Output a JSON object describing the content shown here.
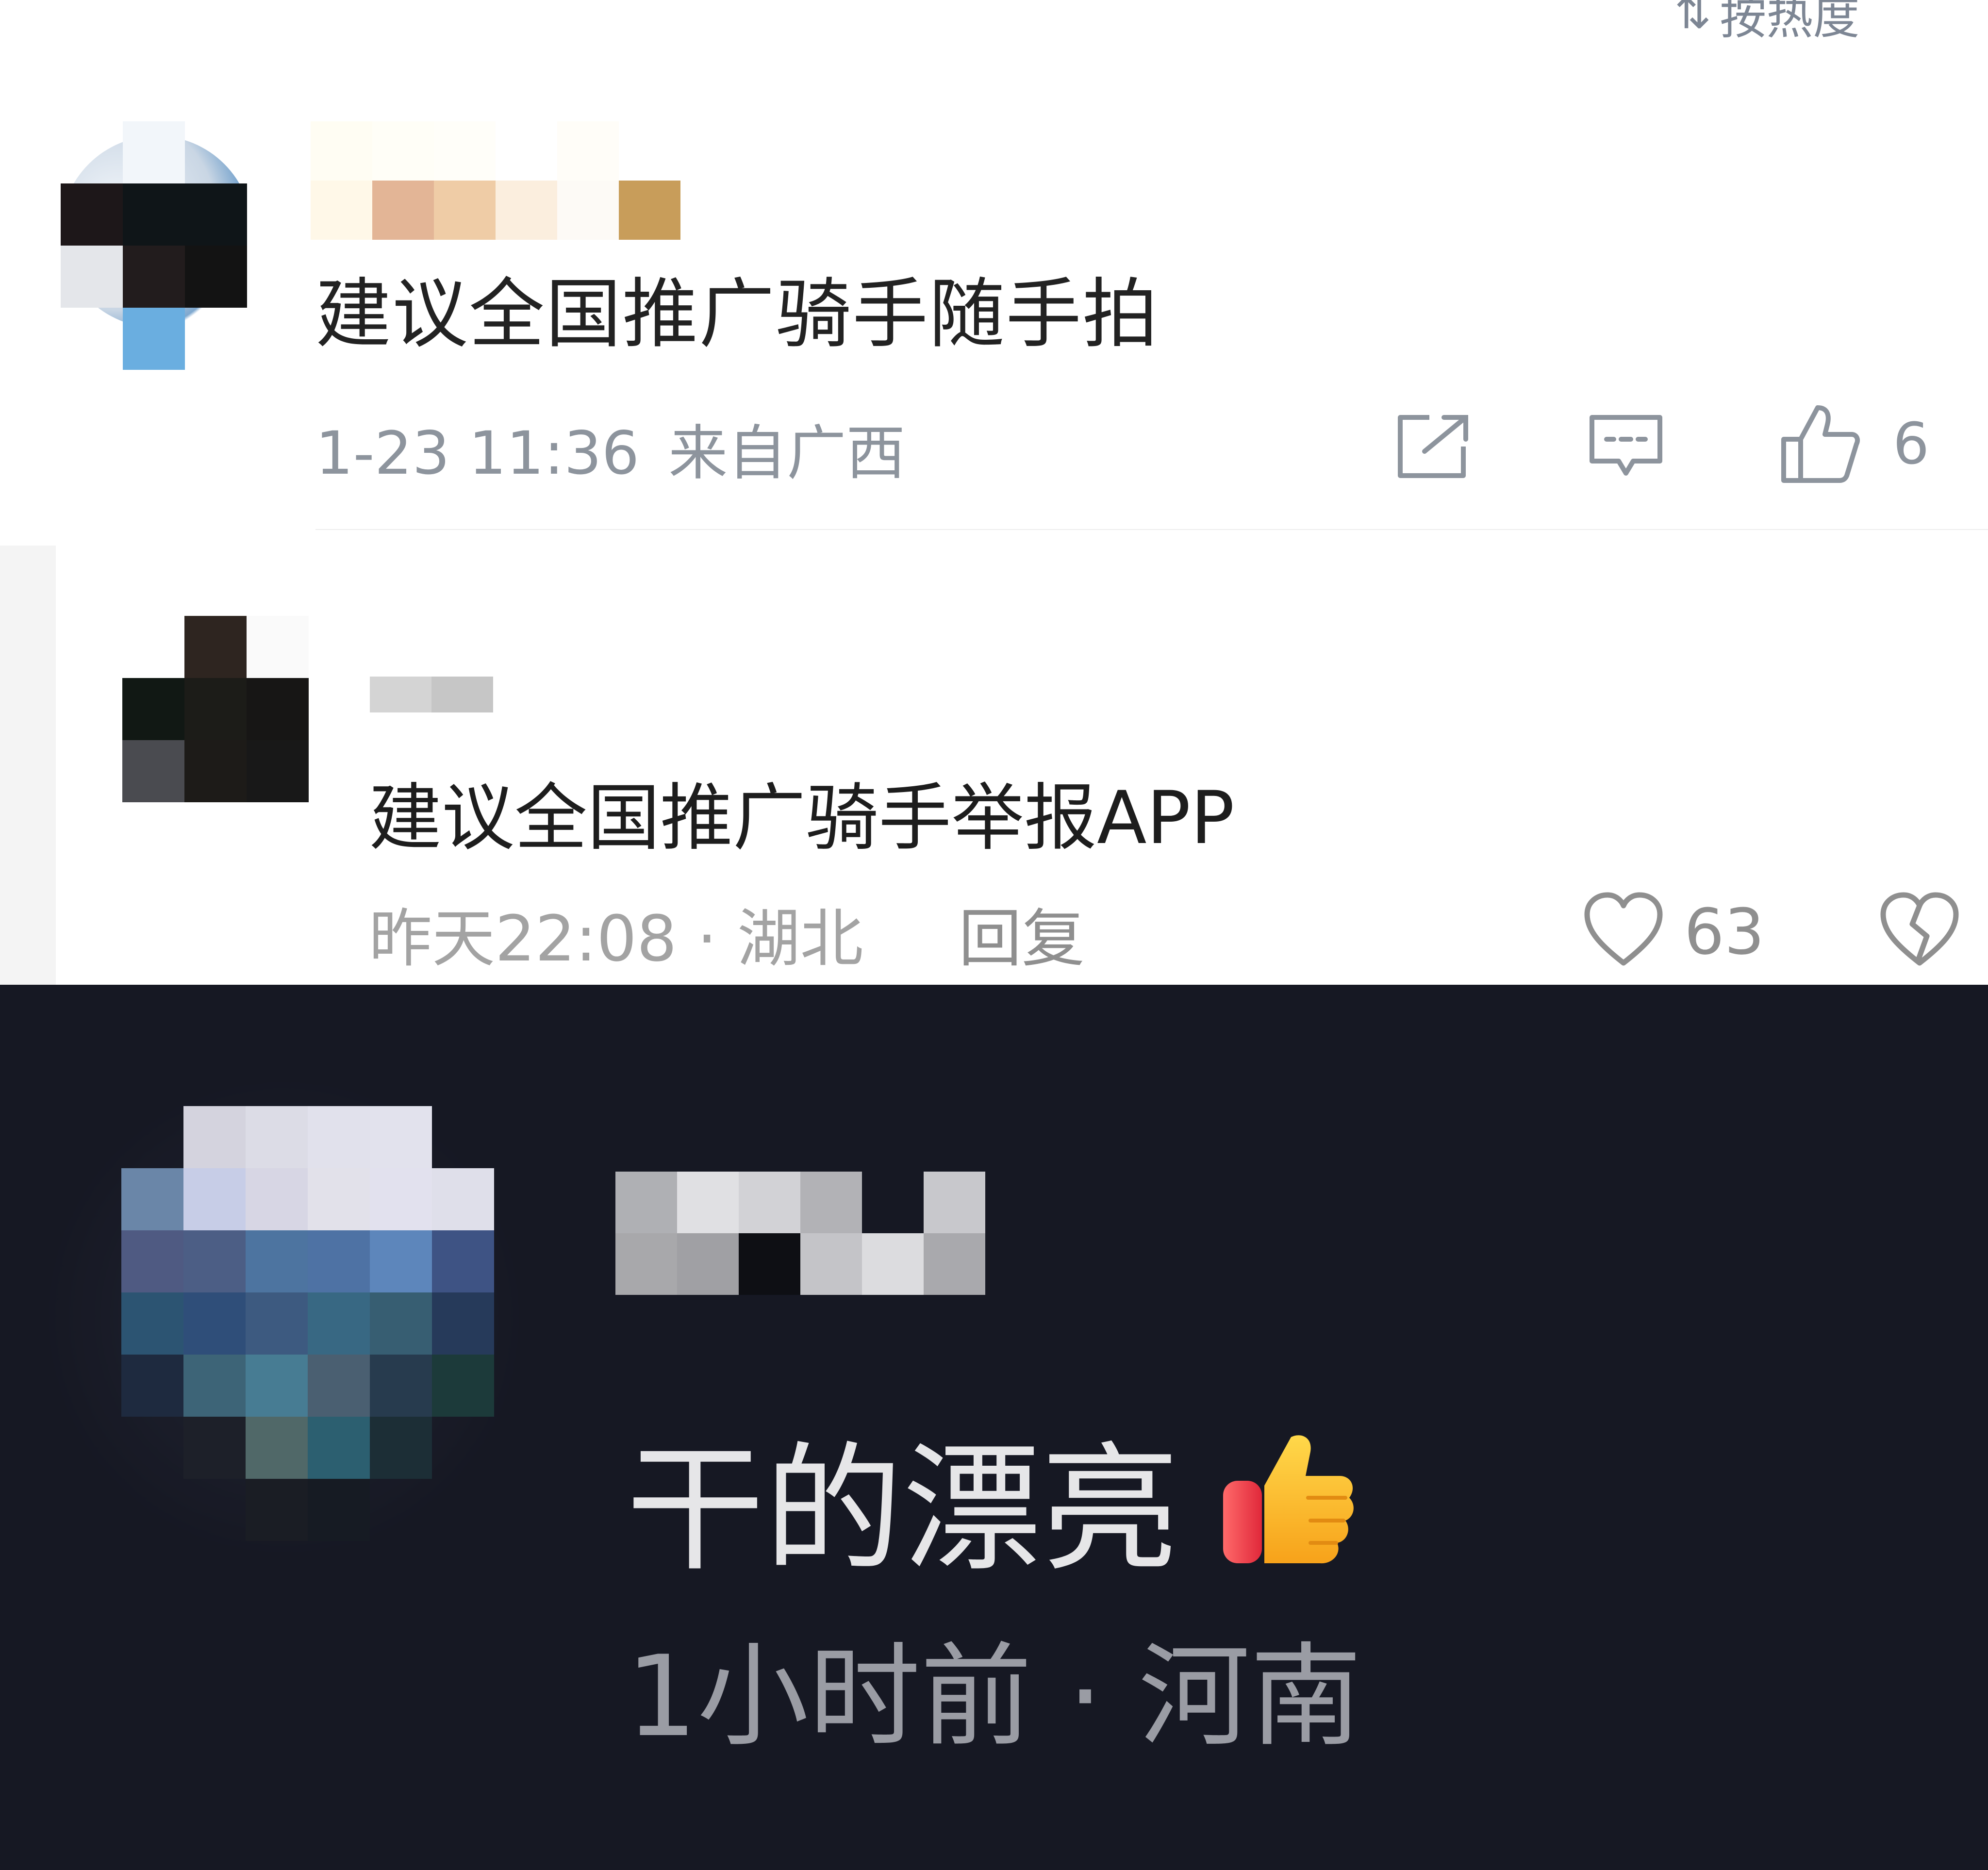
{
  "comment_1": {
    "sort_label": "按热度",
    "text": "建议全国推广骑手随手拍",
    "timestamp": "1-23 11:36",
    "location": "来自广西",
    "like_count": "6",
    "icons": [
      "share-icon",
      "comment-icon",
      "thumbs-up-icon"
    ]
  },
  "comment_2": {
    "text": "建议全国推广骑手举报APP",
    "timestamp": "昨天22:08",
    "separator": "·",
    "location": "湖北",
    "reply_label": "回复",
    "like_count": "63",
    "icons": [
      "heart-icon",
      "dislike-heart-icon"
    ]
  },
  "comment_3": {
    "text": "干的漂亮",
    "emoji": "thumbs-up-emoji",
    "timestamp": "1小时前",
    "separator": "·",
    "location": "河南"
  },
  "colors": {
    "dark_background": "#161823",
    "light_background": "#ffffff",
    "meta_gray": "#8d949d"
  }
}
